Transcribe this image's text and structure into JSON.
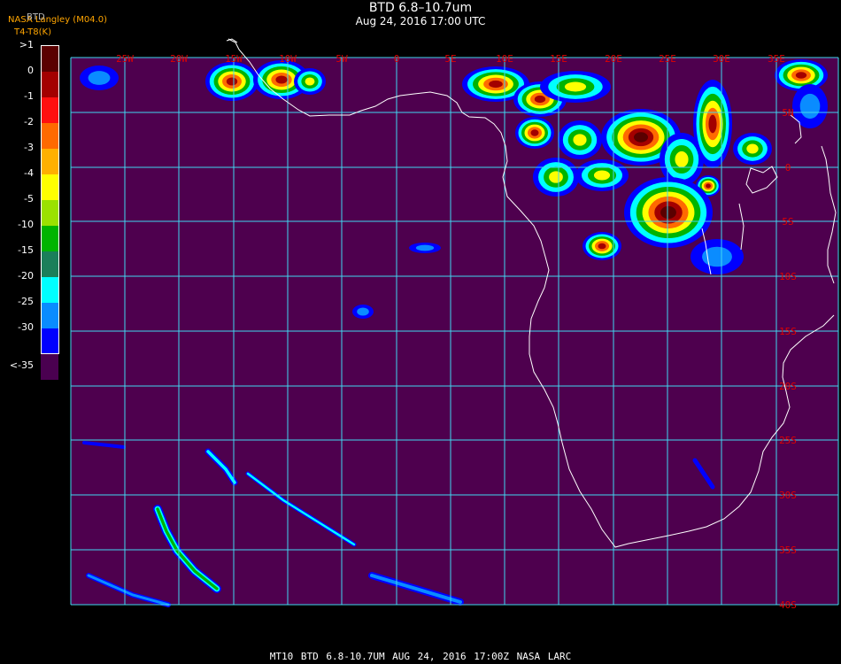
{
  "header": {
    "title": "BTD 6.8–10.7um",
    "subtitle": "Aug 24, 2016 17:00 UTC",
    "credit": "NASA Langley (M04.0)",
    "variable": "BTD",
    "units_label": "T4-T8(K)"
  },
  "legend": {
    "items": [
      {
        "label": ">1",
        "color": "#5a0000"
      },
      {
        "label": "0",
        "color": "#a30000"
      },
      {
        "label": "-1",
        "color": "#ff1010"
      },
      {
        "label": "-2",
        "color": "#ff6a00"
      },
      {
        "label": "-3",
        "color": "#ffb000"
      },
      {
        "label": "-4",
        "color": "#ffff00"
      },
      {
        "label": "-5",
        "color": "#9be100"
      },
      {
        "label": "-10",
        "color": "#00b400"
      },
      {
        "label": "-15",
        "color": "#1b7f5a"
      },
      {
        "label": "-20",
        "color": "#00ffff"
      },
      {
        "label": "-25",
        "color": "#0a8cff"
      },
      {
        "label": "-30",
        "color": "#0000ff"
      },
      {
        "label": "<-35",
        "color": "#4a0050"
      }
    ]
  },
  "map": {
    "background_color": "#4e004e",
    "grid_color": "#40d8f0",
    "label_color": "#e00000",
    "coast_color": "#ffffff",
    "lon_labels": [
      "25W",
      "20W",
      "15W",
      "10W",
      "5W",
      "0",
      "5E",
      "10E",
      "15E",
      "20E",
      "25E",
      "30E",
      "35E"
    ],
    "lat_labels": [
      "5N",
      "0",
      "5S",
      "10S",
      "15S",
      "20S",
      "25S",
      "30S",
      "35S",
      "40S"
    ]
  },
  "footer": {
    "text": "MT10  BTD 6.8-10.7UM   AUG 24, 2016 17:00Z   NASA LARC"
  }
}
